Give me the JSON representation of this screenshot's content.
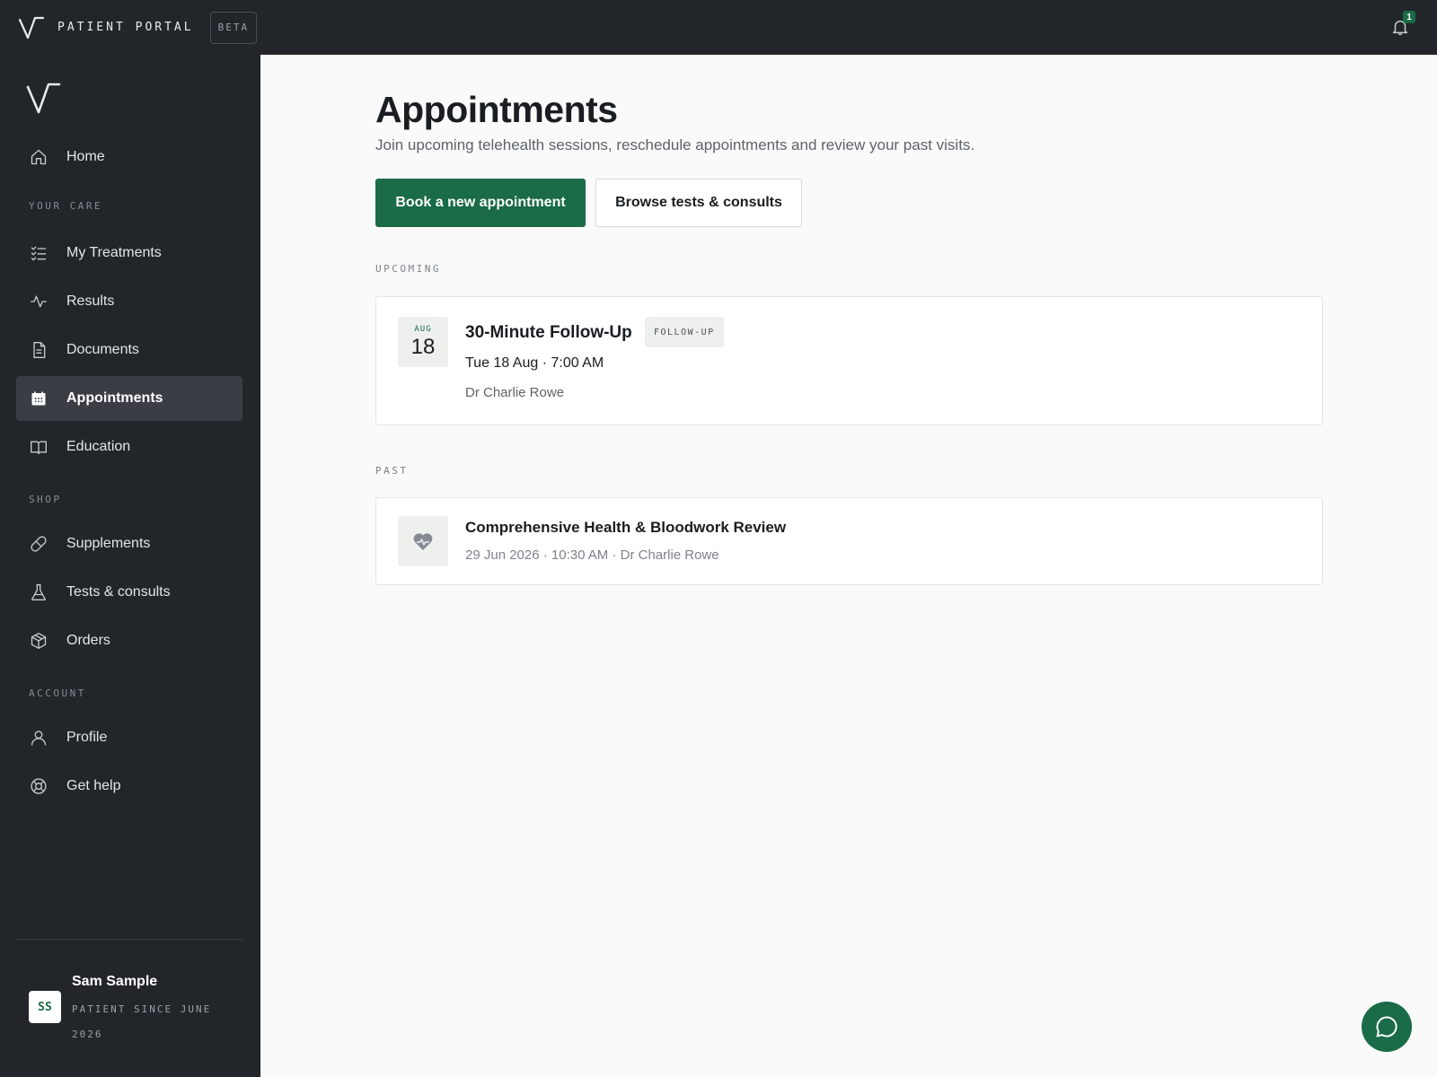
{
  "app": {
    "brand": "PATIENT PORTAL",
    "badge": "BETA",
    "notification_count": "1"
  },
  "sidebar": {
    "items": [
      {
        "label": "Home",
        "icon": "home-icon"
      },
      {
        "label": "My Treatments",
        "icon": "list-icon"
      },
      {
        "label": "Results",
        "icon": "activity-icon"
      },
      {
        "label": "Documents",
        "icon": "document-icon"
      },
      {
        "label": "Appointments",
        "icon": "calendar-icon",
        "active": true
      },
      {
        "label": "Education",
        "icon": "book-icon"
      },
      {
        "label": "Supplements",
        "icon": "pill-icon"
      },
      {
        "label": "Tests & consults",
        "icon": "flask-icon"
      },
      {
        "label": "Orders",
        "icon": "package-icon"
      },
      {
        "label": "Profile",
        "icon": "user-icon"
      },
      {
        "label": "Get help",
        "icon": "lifebuoy-icon"
      }
    ],
    "sections": {
      "care": "YOUR CARE",
      "shop": "SHOP",
      "account": "ACCOUNT"
    },
    "user": {
      "initials": "SS",
      "name": "Sam Sample",
      "since": "PATIENT SINCE JUNE 2026"
    }
  },
  "main": {
    "title": "Appointments",
    "subtitle": "Join upcoming telehealth sessions, reschedule appointments and review your past visits.",
    "primary_button": "Book a new appointment",
    "secondary_button": "Browse tests & consults",
    "upcoming_label": "UPCOMING",
    "past_label": "PAST",
    "upcoming": {
      "month": "AUG",
      "day": "18",
      "title": "30-Minute Follow-Up",
      "tag": "FOLLOW-UP",
      "when": "Tue 18 Aug · 7:00 AM",
      "doctor": "Dr Charlie Rowe"
    },
    "past": {
      "title": "Comprehensive Health & Bloodwork Review",
      "meta": "29 Jun 2026 · 10:30 AM · Dr Charlie Rowe"
    }
  },
  "colors": {
    "accent": "#1a6b47",
    "sidebar_bg": "#22262b",
    "active_item_bg": "#3a3e44"
  }
}
